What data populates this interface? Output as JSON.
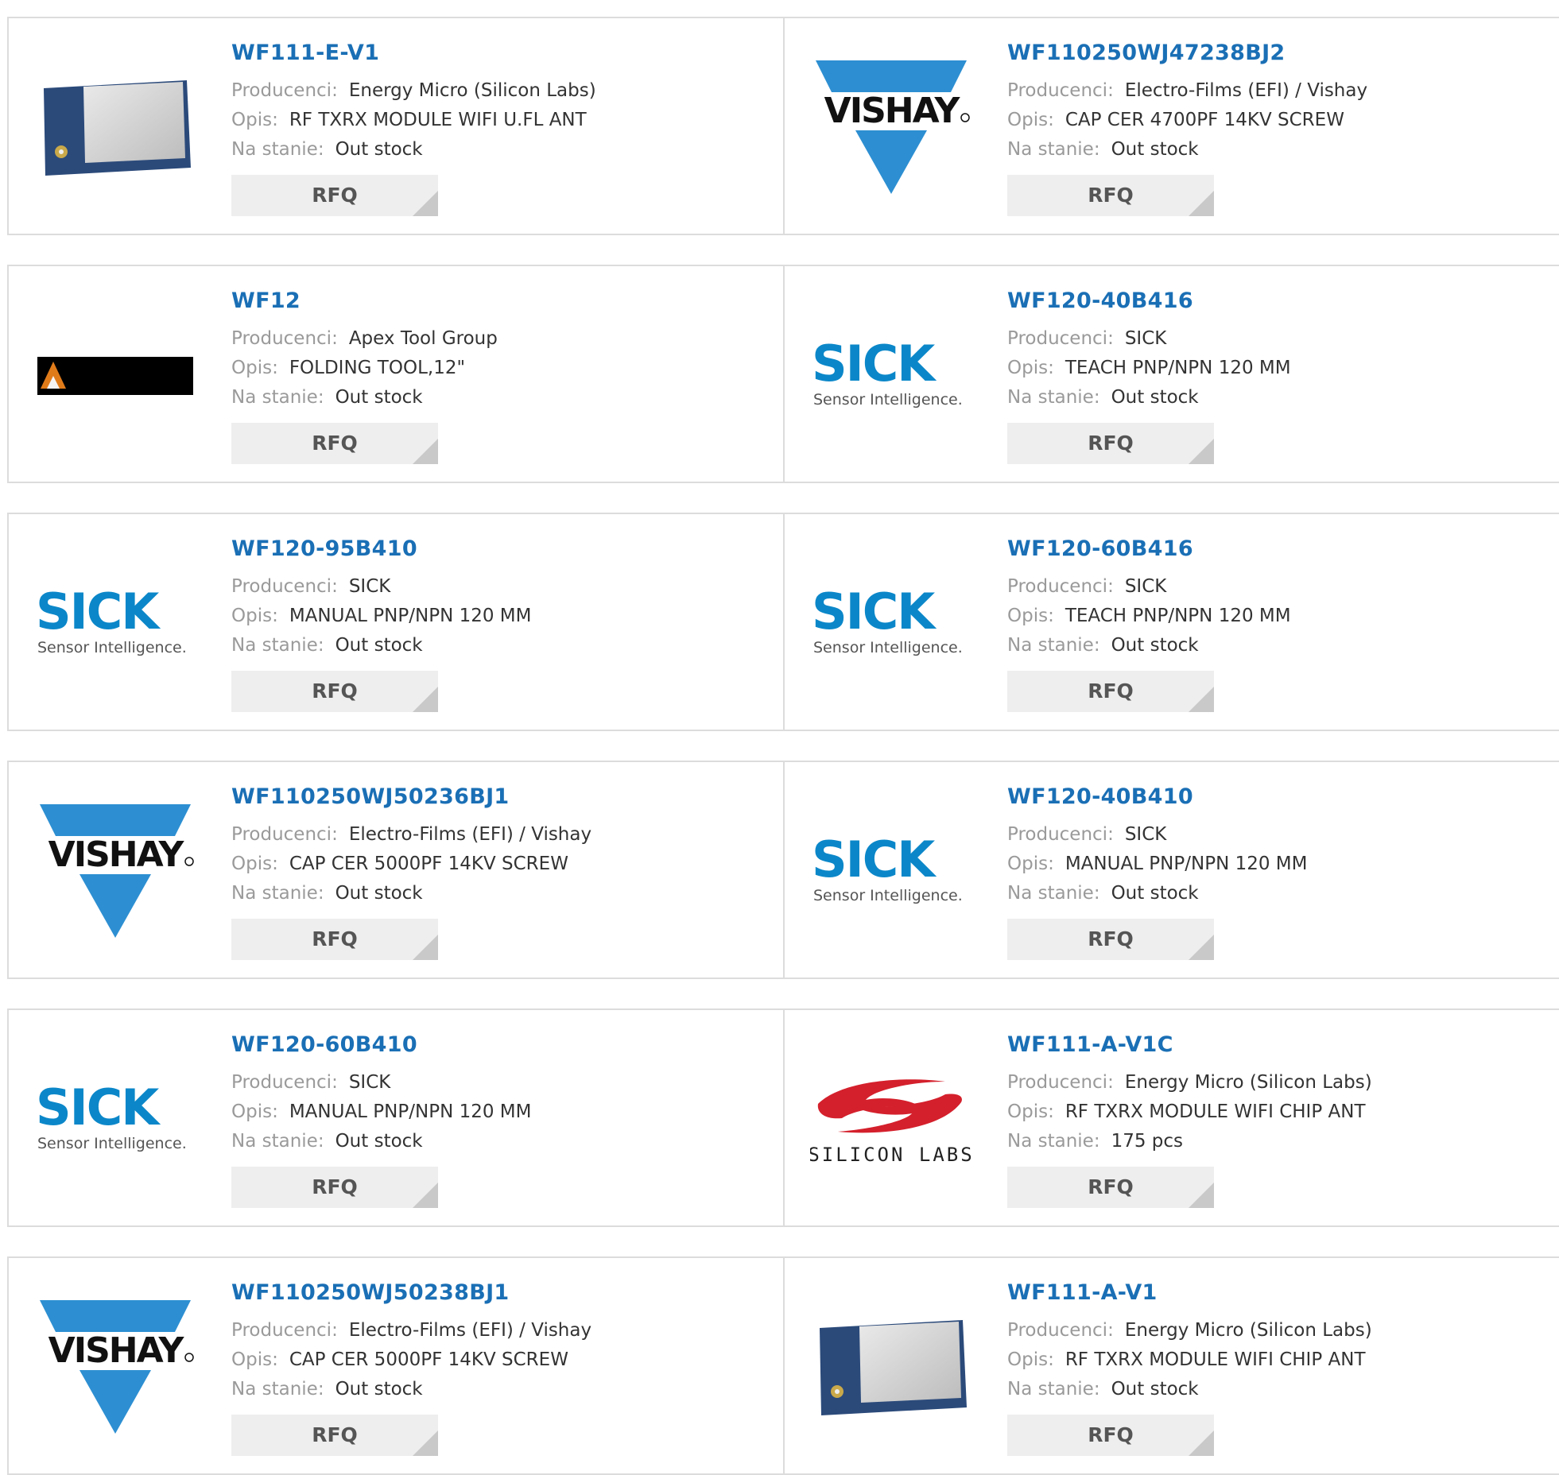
{
  "labels": {
    "manufacturer": "Producenci:",
    "description": "Opis:",
    "stock": "Na stanie:",
    "rfq": "RFQ"
  },
  "logo_text": {
    "vishay": "VISHAY",
    "sick": "SICK",
    "sick_tag": "Sensor Intelligence.",
    "silabs": "SILICON LABS"
  },
  "colors": {
    "link": "#1a6fb5",
    "vishay_blue": "#2d8fd2",
    "sick_blue": "#0b87c9",
    "silabs_red": "#d4202c"
  },
  "products": [
    {
      "pn": "WF111-E-V1",
      "manufacturer": "Energy Micro (Silicon Labs)",
      "description": "RF TXRX MODULE WIFI U.FL ANT",
      "stock": "Out stock",
      "thumb": "module-photo-icon"
    },
    {
      "pn": "WF110250WJ47238BJ2",
      "manufacturer": "Electro-Films (EFI) / Vishay",
      "description": "CAP CER 4700PF 14KV SCREW",
      "stock": "Out stock",
      "thumb": "vishay-logo"
    },
    {
      "pn": "WF12",
      "manufacturer": "Apex Tool Group",
      "description": "FOLDING TOOL,12\"",
      "stock": "Out stock",
      "thumb": "apex-logo"
    },
    {
      "pn": "WF120-40B416",
      "manufacturer": "SICK",
      "description": "TEACH PNP/NPN 120 MM",
      "stock": "Out stock",
      "thumb": "sick-logo"
    },
    {
      "pn": "WF120-95B410",
      "manufacturer": "SICK",
      "description": "MANUAL PNP/NPN 120 MM",
      "stock": "Out stock",
      "thumb": "sick-logo"
    },
    {
      "pn": "WF120-60B416",
      "manufacturer": "SICK",
      "description": "TEACH PNP/NPN 120 MM",
      "stock": "Out stock",
      "thumb": "sick-logo"
    },
    {
      "pn": "WF110250WJ50236BJ1",
      "manufacturer": "Electro-Films (EFI) / Vishay",
      "description": "CAP CER 5000PF 14KV SCREW",
      "stock": "Out stock",
      "thumb": "vishay-logo"
    },
    {
      "pn": "WF120-40B410",
      "manufacturer": "SICK",
      "description": "MANUAL PNP/NPN 120 MM",
      "stock": "Out stock",
      "thumb": "sick-logo"
    },
    {
      "pn": "WF120-60B410",
      "manufacturer": "SICK",
      "description": "MANUAL PNP/NPN 120 MM",
      "stock": "Out stock",
      "thumb": "sick-logo"
    },
    {
      "pn": "WF111-A-V1C",
      "manufacturer": "Energy Micro (Silicon Labs)",
      "description": "RF TXRX MODULE WIFI CHIP ANT",
      "stock": "175 pcs",
      "thumb": "silabs-logo"
    },
    {
      "pn": "WF110250WJ50238BJ1",
      "manufacturer": "Electro-Films (EFI) / Vishay",
      "description": "CAP CER 5000PF 14KV SCREW",
      "stock": "Out stock",
      "thumb": "vishay-logo"
    },
    {
      "pn": "WF111-A-V1",
      "manufacturer": "Energy Micro (Silicon Labs)",
      "description": "RF TXRX MODULE WIFI CHIP ANT",
      "stock": "Out stock",
      "thumb": "module-photo-icon"
    }
  ]
}
